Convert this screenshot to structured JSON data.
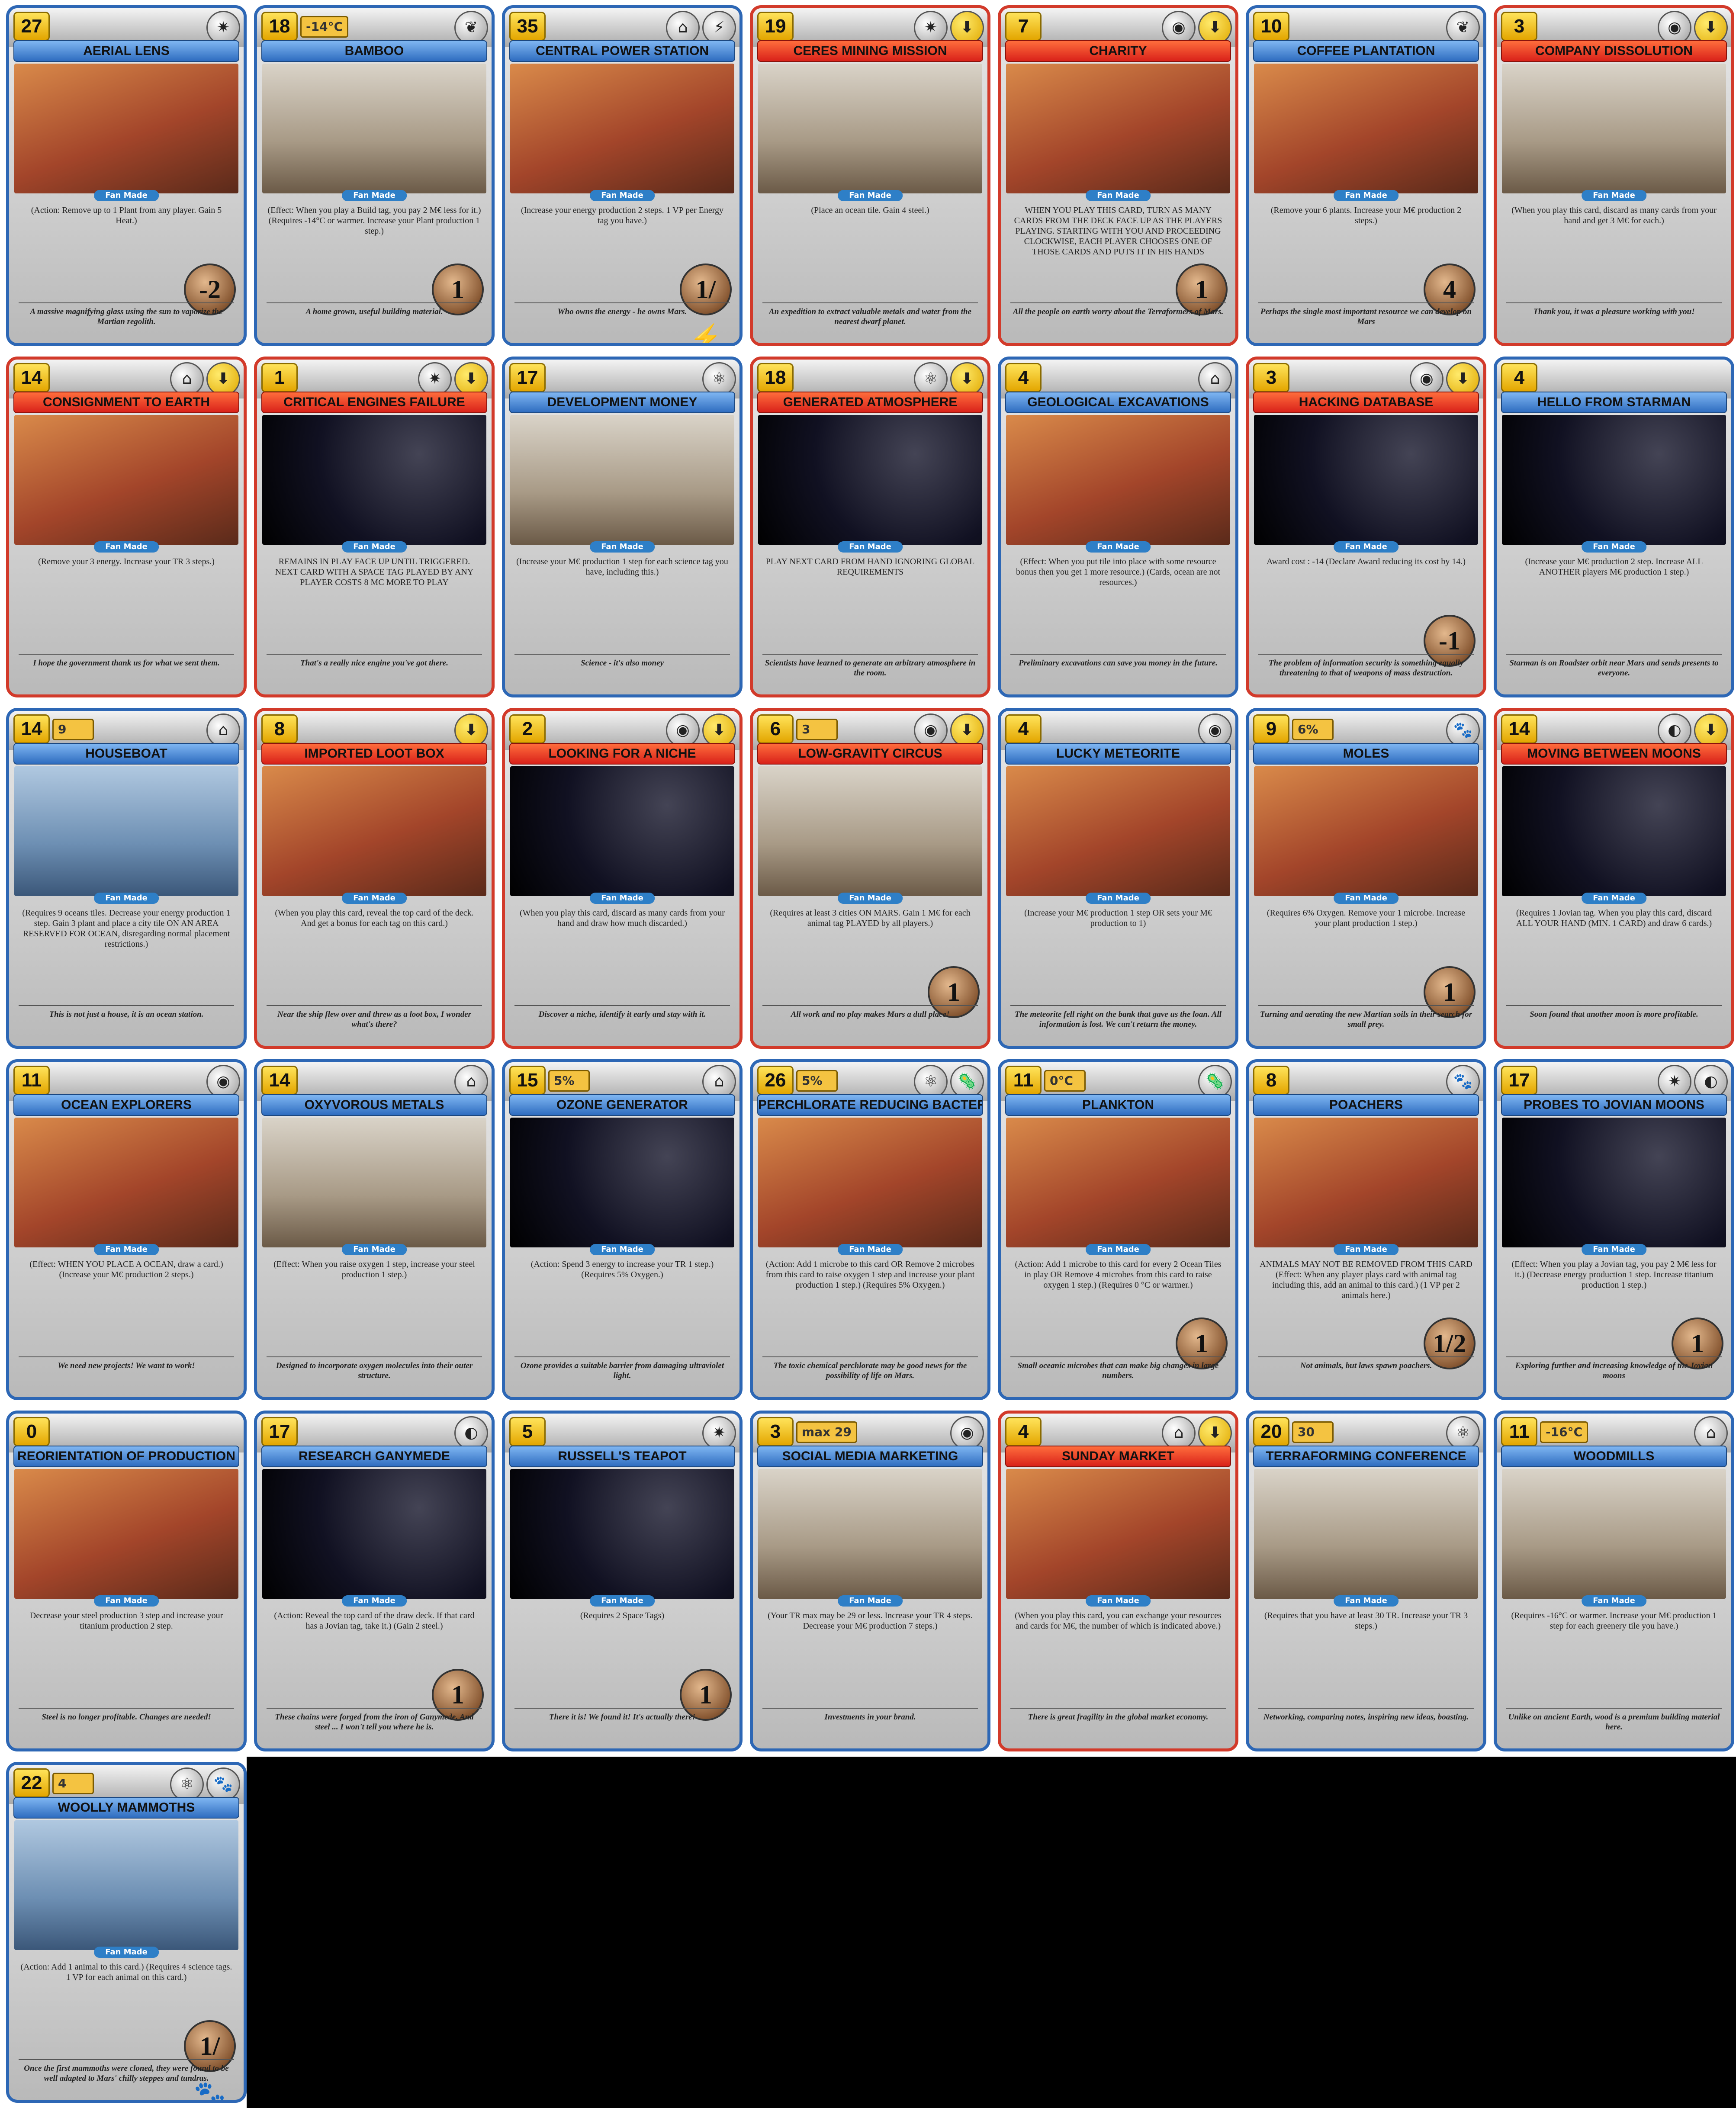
{
  "cards": [
    {
      "name": "AERIAL LENS",
      "cost": "27",
      "type": "auto",
      "tags": [
        "✷"
      ],
      "req": "",
      "effect": "(Action: Remove up to 1 Plant from any player. Gain 5 Heat.)",
      "vp": "-2",
      "flavor": "A massive magnifying glass using the sun to vaporize the Martian regolith.",
      "art": "mars"
    },
    {
      "name": "BAMBOO",
      "cost": "18",
      "type": "auto",
      "tags": [
        "❦"
      ],
      "req": "-14°C",
      "effect": "(Effect: When you play a Build tag, you pay 2 M€ less for it.) (Requires -14°C or warmer. Increase your Plant production 1 step.)",
      "vp": "1",
      "flavor": "A home grown, useful building material.",
      "art": "earth"
    },
    {
      "name": "CENTRAL POWER STATION",
      "cost": "35",
      "type": "auto",
      "tags": [
        "⌂",
        "⚡"
      ],
      "req": "",
      "effect": "(Increase your energy production 2 steps. 1 VP per Energy tag you have.)",
      "vp": "1/⚡",
      "flavor": "Who owns the energy - he owns Mars.",
      "art": "mars"
    },
    {
      "name": "CERES MINING MISSION",
      "cost": "19",
      "type": "event",
      "tags": [
        "✷",
        "⬇"
      ],
      "req": "",
      "effect": "(Place an ocean tile. Gain 4 steel.)",
      "vp": "",
      "flavor": "An expedition to extract valuable metals and water from the nearest dwarf planet.",
      "art": "earth"
    },
    {
      "name": "CHARITY",
      "cost": "7",
      "type": "event",
      "tags": [
        "◉",
        "⬇"
      ],
      "req": "",
      "effect": "WHEN YOU PLAY THIS CARD, TURN AS MANY CARDS FROM THE DECK FACE UP AS THE PLAYERS PLAYING. STARTING WITH YOU AND PROCEEDING CLOCKWISE, EACH PLAYER CHOOSES ONE OF THOSE CARDS AND PUTS IT IN HIS HANDS",
      "vp": "1",
      "flavor": "All the people on earth worry about the Terraformers of Mars.",
      "art": "mars"
    },
    {
      "name": "COFFEE PLANTATION",
      "cost": "10",
      "type": "auto",
      "tags": [
        "❦"
      ],
      "req": "",
      "effect": "(Remove your 6 plants. Increase your M€ production 2 steps.)",
      "vp": "4",
      "flavor": "Perhaps the single most important resource we can develop on Mars",
      "art": "mars"
    },
    {
      "name": "COMPANY DISSOLUTION",
      "cost": "3",
      "type": "event",
      "tags": [
        "◉",
        "⬇"
      ],
      "req": "",
      "effect": "(When you play this card, discard as many cards from your hand and get 3 M€ for each.)",
      "vp": "",
      "flavor": "Thank you, it was a pleasure working with you!",
      "art": "earth"
    },
    {
      "name": "CONSIGNMENT TO EARTH",
      "cost": "14",
      "type": "event",
      "tags": [
        "⌂",
        "⬇"
      ],
      "req": "",
      "effect": "(Remove your 3 energy. Increase your TR 3 steps.)",
      "vp": "",
      "flavor": "I hope the government thank us for what we sent them.",
      "art": "mars"
    },
    {
      "name": "CRITICAL ENGINES FAILURE",
      "cost": "1",
      "type": "event",
      "tags": [
        "✷",
        "⬇"
      ],
      "req": "",
      "effect": "REMAINS IN PLAY FACE UP UNTIL TRIGGERED. NEXT CARD WITH A SPACE TAG PLAYED BY ANY PLAYER COSTS 8 MC MORE TO PLAY",
      "vp": "",
      "flavor": "That's a really nice engine you've got there.",
      "art": "space"
    },
    {
      "name": "DEVELOPMENT MONEY",
      "cost": "17",
      "type": "auto",
      "tags": [
        "⚛"
      ],
      "req": "",
      "effect": "(Increase your M€ production 1 step for each science tag you have, including this.)",
      "vp": "",
      "flavor": "Science - it's also money",
      "art": "earth"
    },
    {
      "name": "GENERATED ATMOSPHERE",
      "cost": "18",
      "type": "event",
      "tags": [
        "⚛",
        "⬇"
      ],
      "req": "",
      "effect": "PLAY NEXT CARD FROM HAND IGNORING GLOBAL REQUIREMENTS",
      "vp": "",
      "flavor": "Scientists have learned to generate an arbitrary atmosphere in the room.",
      "art": "space"
    },
    {
      "name": "GEOLOGICAL EXCAVATIONS",
      "cost": "4",
      "type": "auto",
      "tags": [
        "⌂"
      ],
      "req": "",
      "effect": "(Effect: When you put tile into place with some resource bonus then you get 1 more resource.) (Cards, ocean are not resources.)",
      "vp": "",
      "flavor": "Preliminary excavations can save you money in the future.",
      "art": "mars"
    },
    {
      "name": "HACKING DATABASE",
      "cost": "3",
      "type": "event",
      "tags": [
        "◉",
        "⬇"
      ],
      "req": "",
      "effect": "Award cost : -14 (Declare Award reducing its cost by 14.)",
      "vp": "-1",
      "flavor": "The problem of information security is something equally threatening to that of weapons of mass destruction.",
      "art": "space"
    },
    {
      "name": "HELLO FROM STARMAN",
      "cost": "4",
      "type": "auto",
      "tags": [],
      "req": "",
      "effect": "(Increase your M€ production 2 step. Increase ALL ANOTHER players M€ production 1 step.)",
      "vp": "",
      "flavor": "Starman is on Roadster orbit near Mars and sends presents to everyone.",
      "art": "space"
    },
    {
      "name": "HOUSEBOAT",
      "cost": "14",
      "type": "auto",
      "tags": [
        "⌂"
      ],
      "req": "9",
      "effect": "(Requires 9 oceans tiles. Decrease your energy production 1 step. Gain 3 plant and place a city tile ON AN AREA RESERVED FOR OCEAN, disregarding normal placement restrictions.)",
      "vp": "",
      "flavor": "This is not just a house, it is an ocean station.",
      "art": "blue"
    },
    {
      "name": "IMPORTED LOOT BOX",
      "cost": "8",
      "type": "event",
      "tags": [
        "⬇"
      ],
      "req": "",
      "effect": "(When you play this card, reveal the top card of the deck. And get a bonus for each tag on this card.)",
      "vp": "",
      "flavor": "Near the ship flew over and threw as a loot box, I wonder what's there?",
      "art": "mars"
    },
    {
      "name": "LOOKING FOR A NICHE",
      "cost": "2",
      "type": "event",
      "tags": [
        "◉",
        "⬇"
      ],
      "req": "",
      "effect": "(When you play this card, discard as many cards from your hand and draw how much discarded.)",
      "vp": "",
      "flavor": "Discover a niche, identify it early and stay with it.",
      "art": "space"
    },
    {
      "name": "LOW-GRAVITY CIRCUS",
      "cost": "6",
      "type": "event",
      "tags": [
        "◉",
        "⬇"
      ],
      "req": "3",
      "effect": "(Requires at least 3 cities ON MARS. Gain 1 M€ for each animal tag PLAYED by all players.)",
      "vp": "1",
      "flavor": "All work and no play makes Mars a dull place!",
      "art": "earth"
    },
    {
      "name": "LUCKY METEORITE",
      "cost": "4",
      "type": "auto",
      "tags": [
        "◉"
      ],
      "req": "",
      "effect": "(Increase your M€ production 1 step OR sets your M€ production to 1)",
      "vp": "",
      "flavor": "The meteorite fell right on the bank that gave us the loan. All information is lost. We can't return the money.",
      "art": "mars"
    },
    {
      "name": "MOLES",
      "cost": "9",
      "type": "auto",
      "tags": [
        "🐾"
      ],
      "req": "6%",
      "effect": "(Requires 6% Oxygen. Remove your 1 microbe. Increase your plant production 1 step.)",
      "vp": "1",
      "flavor": "Turning and aerating the new Martian soils in their search for small prey.",
      "art": "mars"
    },
    {
      "name": "MOVING BETWEEN MOONS",
      "cost": "14",
      "type": "event",
      "tags": [
        "◐",
        "⬇"
      ],
      "req": "",
      "effect": "(Requires 1 Jovian tag. When you play this card, discard ALL YOUR HAND (MIN. 1 CARD) and draw 6 cards.)",
      "vp": "",
      "flavor": "Soon found that another moon is more profitable.",
      "art": "space"
    },
    {
      "name": "OCEAN EXPLORERS",
      "cost": "11",
      "type": "auto",
      "tags": [
        "◉"
      ],
      "req": "",
      "effect": "(Effect: WHEN YOU PLACE A OCEAN, draw a card.) (Increase your M€ production 2 steps.)",
      "vp": "",
      "flavor": "We need new projects! We want to work!",
      "art": "mars"
    },
    {
      "name": "OXYVOROUS METALS",
      "cost": "14",
      "type": "auto",
      "tags": [
        "⌂"
      ],
      "req": "",
      "effect": "(Effect: When you raise oxygen 1 step, increase your steel production 1 step.)",
      "vp": "",
      "flavor": "Designed to incorporate oxygen molecules into their outer structure.",
      "art": "earth"
    },
    {
      "name": "OZONE GENERATOR",
      "cost": "15",
      "type": "auto",
      "tags": [
        "⌂"
      ],
      "req": "5%",
      "effect": "(Action: Spend 3 energy to increase your TR 1 step.) (Requires 5% Oxygen.)",
      "vp": "",
      "flavor": "Ozone provides a suitable barrier from damaging ultraviolet light.",
      "art": "space"
    },
    {
      "name": "PERCHLORATE REDUCING BACTERIA",
      "cost": "26",
      "type": "auto",
      "tags": [
        "⚛",
        "🦠"
      ],
      "req": "5%",
      "effect": "(Action: Add 1 microbe to this card OR Remove 2 microbes from this card to raise oxygen 1 step and increase your plant production 1 step.) (Requires 5% Oxygen.)",
      "vp": "",
      "flavor": "The toxic chemical perchlorate may be good news for the possibility of life on Mars.",
      "art": "mars"
    },
    {
      "name": "PLANKTON",
      "cost": "11",
      "type": "auto",
      "tags": [
        "🦠"
      ],
      "req": "0°C",
      "effect": "(Action: Add 1 microbe to this card for every 2 Ocean Tiles in play OR Remove 4 microbes from this card to raise oxygen 1 step.) (Requires 0 °C or warmer.)",
      "vp": "1",
      "flavor": "Small oceanic microbes that can make big changes in large numbers.",
      "art": "mars"
    },
    {
      "name": "POACHERS",
      "cost": "8",
      "type": "auto",
      "tags": [
        "🐾"
      ],
      "req": "",
      "effect": "ANIMALS MAY NOT BE REMOVED FROM THIS CARD (Effect: When any player plays card with animal tag including this, add an animal to this card.) (1 VP per 2 animals here.)",
      "vp": "1/2",
      "flavor": "Not animals, but laws spawn poachers.",
      "art": "mars"
    },
    {
      "name": "PROBES TO JOVIAN MOONS",
      "cost": "17",
      "type": "auto",
      "tags": [
        "✷",
        "◐"
      ],
      "req": "",
      "effect": "(Effect: When you play a Jovian tag, you pay 2 M€ less for it.) (Decrease energy production 1 step. Increase titanium production 1 step.)",
      "vp": "1",
      "flavor": "Exploring further and increasing knowledge of the Jovian moons",
      "art": "space"
    },
    {
      "name": "REORIENTATION OF PRODUCTION",
      "cost": "0",
      "type": "auto",
      "tags": [],
      "req": "",
      "effect": "Decrease your steel production 3 step and increase your titanium production 2 step.",
      "vp": "",
      "flavor": "Steel is no longer profitable. Changes are needed!",
      "art": "mars"
    },
    {
      "name": "RESEARCH GANYMEDE",
      "cost": "17",
      "type": "auto",
      "tags": [
        "◐"
      ],
      "req": "",
      "effect": "(Action: Reveal the top card of the draw deck. If that card has a Jovian tag, take it.) (Gain 2 steel.)",
      "vp": "1",
      "flavor": "These chains were forged from the iron of Ganymede. And steel ... I won't tell you where he is.",
      "art": "space"
    },
    {
      "name": "RUSSELL'S TEAPOT",
      "cost": "5",
      "type": "auto",
      "tags": [
        "✷"
      ],
      "req": "",
      "effect": "(Requires 2 Space Tags)",
      "vp": "1",
      "flavor": "There it is! We found it! It's actually there!",
      "art": "space"
    },
    {
      "name": "SOCIAL MEDIA MARKETING",
      "cost": "3",
      "type": "auto",
      "tags": [
        "◉"
      ],
      "req": "max 29",
      "effect": "(Your TR max may be 29 or less. Increase your TR 4 steps. Decrease your M€ production 7 steps.)",
      "vp": "",
      "flavor": "Investments in your brand.",
      "art": "earth"
    },
    {
      "name": "SUNDAY MARKET",
      "cost": "4",
      "type": "event",
      "tags": [
        "⌂",
        "⬇"
      ],
      "req": "",
      "effect": "(When you play this card, you can exchange your resources and cards for M€, the number of which is indicated above.)",
      "vp": "",
      "flavor": "There is great fragility in the global market economy.",
      "art": "mars"
    },
    {
      "name": "TERRAFORMING CONFERENCE",
      "cost": "20",
      "type": "auto",
      "tags": [
        "⚛"
      ],
      "req": "30",
      "effect": "(Requires that you have at least 30 TR. Increase your TR 3 steps.)",
      "vp": "",
      "flavor": "Networking, comparing notes, inspiring new ideas, boasting.",
      "art": "earth"
    },
    {
      "name": "WOODMILLS",
      "cost": "11",
      "type": "auto",
      "tags": [
        "⌂"
      ],
      "req": "-16°C",
      "effect": "(Requires -16°C or warmer. Increase your M€ production 1 step for each greenery tile you have.)",
      "vp": "",
      "flavor": "Unlike on ancient Earth, wood is a premium building material here.",
      "art": "earth"
    },
    {
      "name": "WOOLLY MAMMOTHS",
      "cost": "22",
      "type": "auto",
      "tags": [
        "⚛",
        "🐾"
      ],
      "req": "4",
      "effect": "(Action: Add 1 animal to this card.) (Requires 4 science tags. 1 VP for each animal on this card.)",
      "vp": "1/🐾",
      "flavor": "Once the first mammoths were cloned, they were found to be well adapted to Mars' chilly steppes and tundras.",
      "art": "blue"
    }
  ],
  "fan_made_label": "Fan Made"
}
